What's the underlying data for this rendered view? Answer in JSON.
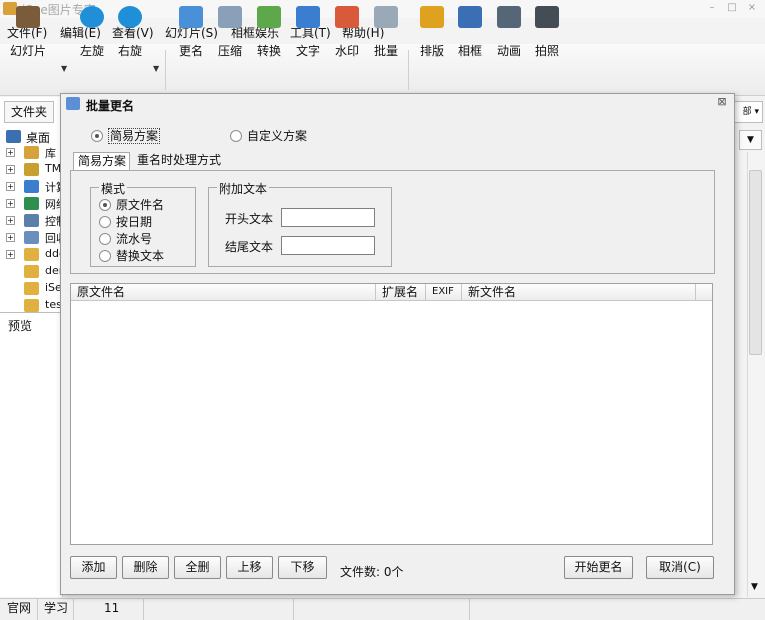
{
  "window": {
    "title": "iSee图片专家",
    "controls": [
      "–",
      "□",
      "×"
    ]
  },
  "menu": [
    "文件(F)",
    "编辑(E)",
    "查看(V)",
    "幻灯片(S)",
    "相框娱乐",
    "工具(T)",
    "帮助(H)"
  ],
  "toolbar": {
    "slideshow": "幻灯片",
    "rotate_left": "左旋",
    "rotate_right": "右旋",
    "rename": "更名",
    "compress": "压缩",
    "convert": "转换",
    "text": "文字",
    "watermark": "水印",
    "batch": "批量",
    "layout": "排版",
    "frame": "相框",
    "animation": "动画",
    "photo": "拍照"
  },
  "left_panel": {
    "tab": "文件夹",
    "tree": [
      {
        "label": "桌面",
        "expander": ""
      },
      {
        "label": "库",
        "expander": "+"
      },
      {
        "label": "TMC",
        "expander": "+"
      },
      {
        "label": "计算",
        "expander": "+"
      },
      {
        "label": "网络",
        "expander": "+"
      },
      {
        "label": "控制",
        "expander": "+"
      },
      {
        "label": "回收",
        "expander": "+"
      },
      {
        "label": "ddd",
        "expander": "+"
      },
      {
        "label": "dem",
        "expander": ""
      },
      {
        "label": "iSe",
        "expander": ""
      },
      {
        "label": "tes",
        "expander": ""
      }
    ],
    "preview_label": "预览"
  },
  "right_panel": {
    "top_text": "部"
  },
  "status_bar": [
    "官网",
    "学习",
    "11"
  ],
  "dialog": {
    "title": "批量更名",
    "scheme_simple": "简易方案",
    "scheme_custom": "自定义方案",
    "tab_simple": "简易方案",
    "tab_duplicate": "重名时处理方式",
    "mode_group": "模式",
    "modes": [
      "原文件名",
      "按日期",
      "流水号",
      "替换文本"
    ],
    "selected_mode": "原文件名",
    "extra_group": "附加文本",
    "prefix_label": "开头文本",
    "suffix_label": "结尾文本",
    "prefix_value": "",
    "suffix_value": "",
    "columns": [
      "原文件名",
      "扩展名",
      "EXIF",
      "新文件名"
    ],
    "buttons": {
      "add": "添加",
      "remove": "删除",
      "clear": "全删",
      "up": "上移",
      "down": "下移",
      "start": "开始更名",
      "cancel": "取消(C)"
    },
    "file_count": "文件数: 0个"
  }
}
